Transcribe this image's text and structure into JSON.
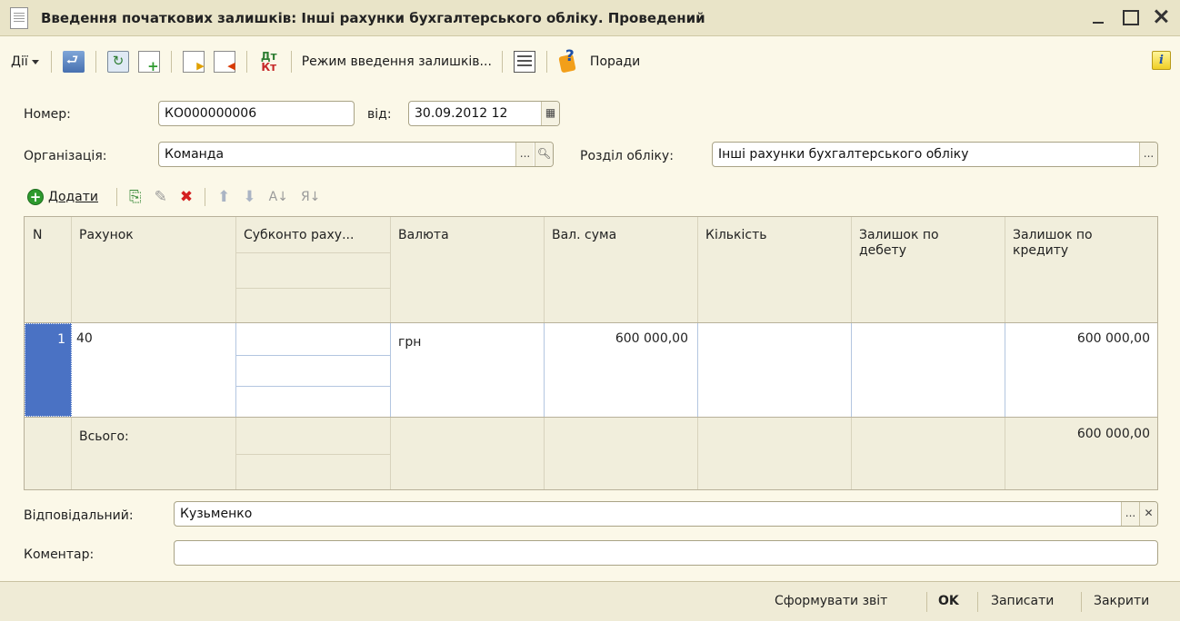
{
  "window": {
    "title": "Введення початкових залишків: Інші рахунки бухгалтерського обліку. Проведений"
  },
  "toolbar": {
    "actions_label": "Дії",
    "balance_mode_label": "Режим введення залишків...",
    "tips_label": "Поради",
    "dtkt_top": "Дт",
    "dtkt_bottom": "Кт",
    "info_label": "i"
  },
  "form": {
    "number_label": "Номер:",
    "number_value": "КО000000006",
    "from_label": "від:",
    "date_value": "30.09.2012 12",
    "organization_label": "Організація:",
    "organization_value": "Команда",
    "section_label": "Розділ обліку:",
    "section_value": "Інші рахунки бухгалтерського обліку"
  },
  "table_toolbar": {
    "add_label": "Додати"
  },
  "table": {
    "columns": [
      "N",
      "Рахунок",
      "Субконто раху...",
      "Валюта",
      "Вал. сума",
      "Кількість",
      "Залишок по дебету",
      "Залишок по кредиту"
    ],
    "rows": [
      {
        "n": "1",
        "account": "40",
        "subconto": "",
        "currency": "грн",
        "cur_sum": "600 000,00",
        "quantity": "",
        "debit": "",
        "credit": "600 000,00"
      }
    ],
    "footer": {
      "label": "Всього:",
      "credit_total": "600 000,00"
    }
  },
  "bottom_form": {
    "responsible_label": "Відповідальний:",
    "responsible_value": "Кузьменко",
    "comment_label": "Коментар:",
    "comment_value": ""
  },
  "bottom_bar": {
    "report_label": "Сформувати звіт",
    "ok_label": "OK",
    "save_label": "Записати",
    "close_label": "Закрити"
  },
  "colors": {
    "background": "#fbf8e8",
    "titlebar": "#e9e4c8",
    "selection": "#4a72c4"
  }
}
